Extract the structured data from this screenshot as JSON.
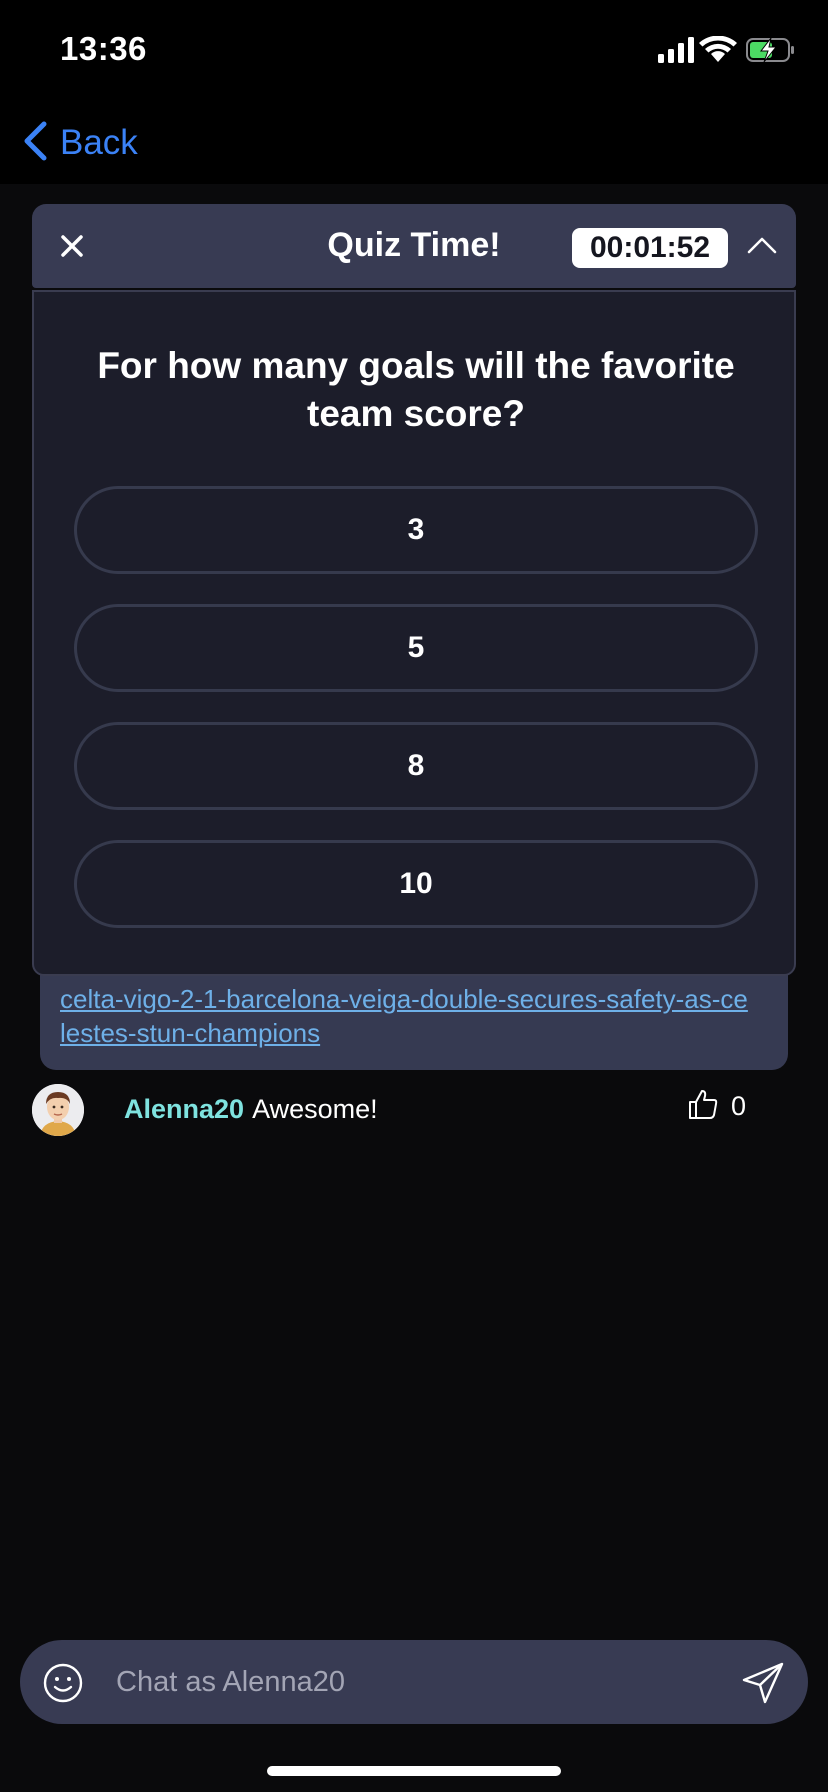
{
  "status_bar": {
    "time": "13:36",
    "icons": [
      "cellular-signal-icon",
      "wifi-icon",
      "battery-charging-icon"
    ]
  },
  "nav": {
    "back_label": "Back",
    "back_icon": "chevron-left-icon"
  },
  "quiz": {
    "title": "Quiz Time!",
    "timer": "00:01:52",
    "close_icon": "close-icon",
    "collapse_icon": "chevron-up-icon",
    "question": "For how many goals will the favorite team score?",
    "options": [
      {
        "label": "3"
      },
      {
        "label": "5"
      },
      {
        "label": "8"
      },
      {
        "label": "10"
      }
    ]
  },
  "link_card": {
    "link_text": "celta-vigo-2-1-barcelona-veiga-double-secures-safety-as-celestes-stun-champions"
  },
  "chat": {
    "messages": [
      {
        "username": "Alenna20",
        "text": "Awesome!",
        "likes": "0"
      }
    ]
  },
  "chat_input": {
    "placeholder": "Chat as Alenna20",
    "emoji_icon": "emoji-smile-icon",
    "send_icon": "send-paper-plane-icon"
  },
  "colors": {
    "accent_blue": "#3b82f6",
    "username_teal": "#7fe3e0",
    "link_blue": "#6eb0e8",
    "quiz_header_bg": "#383b53",
    "quiz_body_bg": "#1c1d2a"
  }
}
